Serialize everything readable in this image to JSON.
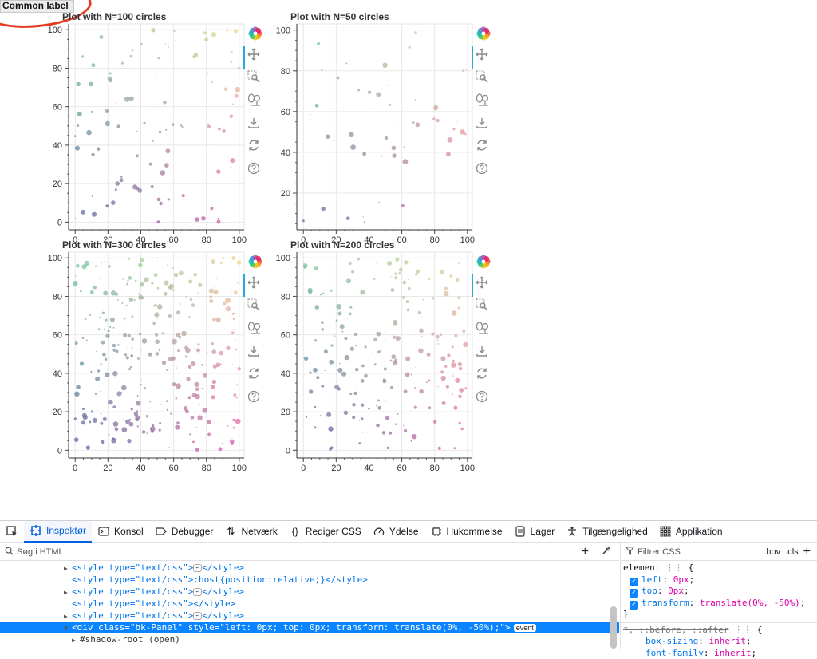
{
  "page": {
    "common_label": "Common label"
  },
  "plots": [
    {
      "title": "Plot with N=100 circles",
      "x_ticks": [
        "0",
        "20",
        "40",
        "60",
        "80",
        "100"
      ],
      "y_ticks": [
        "0",
        "20",
        "40",
        "60",
        "80",
        "100"
      ],
      "ylim": [
        -4,
        103
      ],
      "xlim": [
        -4,
        103
      ],
      "count": 100,
      "seed": 11
    },
    {
      "title": "Plot with N=50 circles",
      "x_ticks": [
        "0",
        "20",
        "40",
        "60",
        "80",
        "100"
      ],
      "y_ticks": [
        "20",
        "40",
        "60",
        "80",
        "100"
      ],
      "ylim": [
        2,
        103
      ],
      "xlim": [
        -4,
        103
      ],
      "count": 50,
      "seed": 23
    },
    {
      "title": "Plot with N=300 circles",
      "x_ticks": [
        "0",
        "20",
        "40",
        "60",
        "80",
        "100"
      ],
      "y_ticks": [
        "0",
        "20",
        "40",
        "60",
        "80",
        "100"
      ],
      "ylim": [
        -4,
        103
      ],
      "xlim": [
        -4,
        103
      ],
      "count": 300,
      "seed": 37
    },
    {
      "title": "Plot with N=200 circles",
      "x_ticks": [
        "0",
        "20",
        "40",
        "60",
        "80",
        "100"
      ],
      "y_ticks": [
        "0",
        "20",
        "40",
        "60",
        "80",
        "100"
      ],
      "ylim": [
        -4,
        103
      ],
      "xlim": [
        -4,
        103
      ],
      "count": 200,
      "seed": 53
    }
  ],
  "toolbar": {
    "tools": [
      "bokeh-logo-icon",
      "pan-icon",
      "box-zoom-icon",
      "wheel-zoom-icon",
      "save-icon",
      "reset-icon",
      "help-icon"
    ]
  },
  "devtools": {
    "tabs": [
      "Inspektør",
      "Konsol",
      "Debugger",
      "Netværk",
      "Rediger CSS",
      "Ydelse",
      "Hukommelse",
      "Lager",
      "Tilgængelighed",
      "Applikation"
    ],
    "search_placeholder": "Søg i HTML",
    "css_filter_placeholder": "Filtrer CSS",
    "hov": ":hov",
    "cls": ".cls",
    "html_lines": [
      {
        "text": "<style type=\"text/css\">",
        "close": "</style>",
        "collapsed": true
      },
      {
        "text": "<style type=\"text/css\">:host{position:relative;}</style>",
        "close": "",
        "collapsed": false
      },
      {
        "text": "<style type=\"text/css\">",
        "close": "</style>",
        "collapsed": true
      },
      {
        "text": "<style type=\"text/css\"></style>",
        "close": "",
        "collapsed": false
      },
      {
        "text": "<style type=\"text/css\">",
        "close": "</style>",
        "collapsed": true
      }
    ],
    "selected_line": "<div class=\"bk-Panel\" style=\"left: 0px; top: 0px; transform: translate(0%, -50%);\">",
    "event_badge": "event",
    "shadow_root": "#shadow-root (open)",
    "element_rule": {
      "selector": "element",
      "props": [
        {
          "name": "left",
          "value": "0px"
        },
        {
          "name": "top",
          "value": "0px"
        },
        {
          "name": "transform",
          "value": "translate(0%, -50%)"
        }
      ]
    },
    "universal_rule": {
      "selector": "*, ::before, ::after",
      "props": [
        {
          "name": "box-sizing",
          "value": "inherit"
        },
        {
          "name": "font-family",
          "value": "inherit"
        }
      ]
    }
  }
}
